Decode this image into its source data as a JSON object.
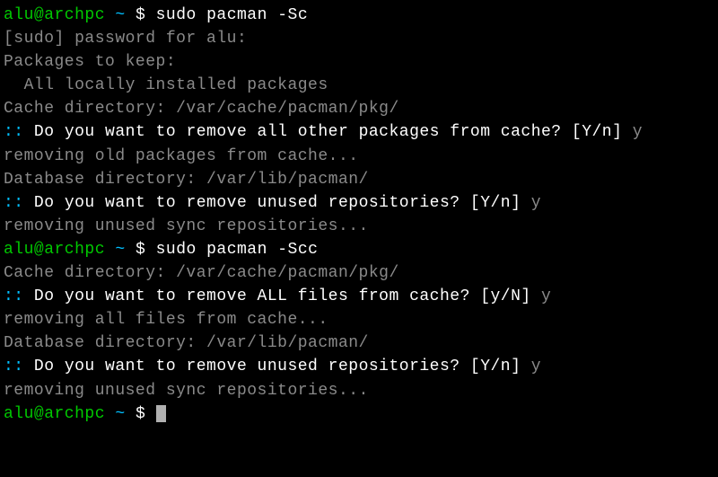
{
  "prompt1": {
    "user_host": "alu@archpc",
    "path": "~",
    "dollar": "$",
    "command": "sudo pacman -Sc"
  },
  "line_sudo_pw": "[sudo] password for alu:",
  "line_pkgs_keep": "Packages to keep:",
  "line_all_local": "  All locally installed packages",
  "blank": "",
  "line_cache_dir1": "Cache directory: /var/cache/pacman/pkg/",
  "q1": {
    "colon": "::",
    "question": " Do you want to remove all other packages from cache? [Y/n] ",
    "answer": "y"
  },
  "line_removing_old": "removing old packages from cache...",
  "line_db_dir1": "Database directory: /var/lib/pacman/",
  "q2": {
    "colon": "::",
    "question": " Do you want to remove unused repositories? [Y/n] ",
    "answer": "y"
  },
  "line_removing_sync1": "removing unused sync repositories...",
  "prompt2": {
    "user_host": "alu@archpc",
    "path": "~",
    "dollar": "$",
    "command": "sudo pacman -Scc"
  },
  "line_cache_dir2": "Cache directory: /var/cache/pacman/pkg/",
  "q3": {
    "colon": "::",
    "question": " Do you want to remove ALL files from cache? [y/N] ",
    "answer": "y"
  },
  "line_removing_all": "removing all files from cache...",
  "line_db_dir2": "Database directory: /var/lib/pacman/",
  "q4": {
    "colon": "::",
    "question": " Do you want to remove unused repositories? [Y/n] ",
    "answer": "y"
  },
  "line_removing_sync2": "removing unused sync repositories...",
  "prompt3": {
    "user_host": "alu@archpc",
    "path": "~",
    "dollar": "$",
    "command": ""
  }
}
